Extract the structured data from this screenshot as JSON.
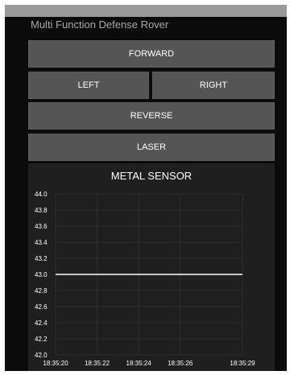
{
  "app": {
    "title": "Multi Function Defense Rover"
  },
  "controls": {
    "forward": "FORWARD",
    "left": "LEFT",
    "right": "RIGHT",
    "reverse": "REVERSE",
    "laser": "LASER"
  },
  "chart_data": {
    "type": "line",
    "title": "METAL SENSOR",
    "xlabel": "",
    "ylabel": "",
    "ylim": [
      42.0,
      44.0
    ],
    "yticks": [
      "44.0",
      "43.8",
      "43.6",
      "43.4",
      "43.2",
      "43.0",
      "42.8",
      "42.6",
      "42.4",
      "42.2",
      "42.0"
    ],
    "xticks": [
      {
        "label": "18:35:20",
        "seconds": 20
      },
      {
        "label": "18:35:22",
        "seconds": 22
      },
      {
        "label": "18:35:24",
        "seconds": 24
      },
      {
        "label": "18:35:26",
        "seconds": 26
      },
      {
        "label": "18:35:29",
        "seconds": 29
      }
    ],
    "xlim_seconds": [
      20,
      29
    ],
    "grid": true,
    "series": [
      {
        "values": [
          {
            "x": "18:35:20",
            "y": 43.0
          },
          {
            "x": "18:35:29",
            "y": 43.0
          }
        ],
        "color": "#ffffff"
      }
    ]
  },
  "colors": {
    "button": "#555555",
    "background": "#0b0b0b",
    "chart_background": "#1f1f1f",
    "grid": "#3a3a3a"
  }
}
